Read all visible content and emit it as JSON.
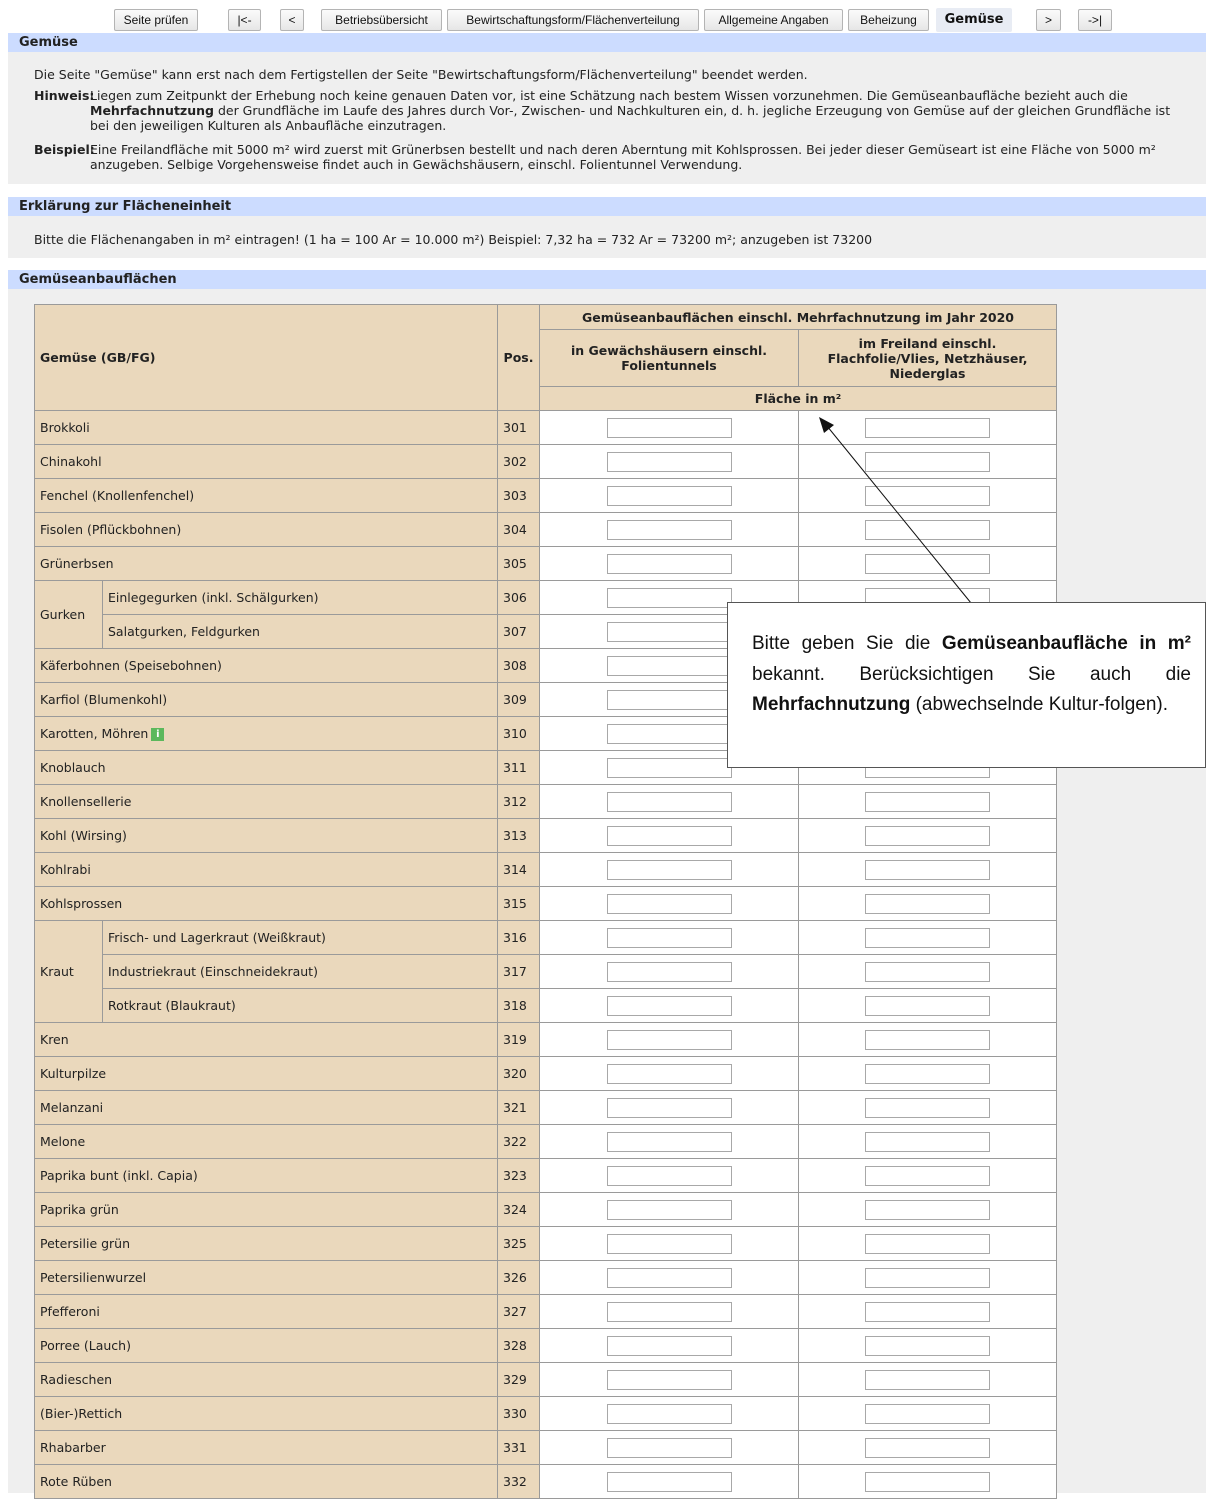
{
  "nav": {
    "check_label": "Seite prüfen",
    "first_label": "|<-",
    "prev_label": "<",
    "tab1": "Betriebsübersicht",
    "tab2": "Bewirtschaftungsform/Flächenverteilung",
    "tab3": "Allgemeine Angaben",
    "tab4": "Beheizung",
    "tab5": "Gemüse",
    "next_label": ">",
    "last_label": "->|"
  },
  "section_gemuese": {
    "title": "Gemüse",
    "intro": "Die Seite \"Gemüse\" kann erst nach dem Fertigstellen der Seite \"Bewirtschaftungsform/Flächenverteilung\" beendet werden.",
    "hint_label": "Hinweis:",
    "hint_part1": "Liegen zum Zeitpunkt der Erhebung noch keine genauen Daten vor, ist eine Schätzung nach bestem Wissen vorzunehmen. Die Gemüseanbaufläche bezieht auch die ",
    "hint_bold": "Mehrfachnutzung",
    "hint_part2": " der Grundfläche im Laufe des Jahres durch Vor-, Zwischen- und Nachkulturen ein, d. h. jegliche Erzeugung von Gemüse auf der gleichen Grundfläche ist bei den jeweiligen Kulturen als Anbaufläche einzutragen.",
    "example_label": "Beispiel:",
    "example_text": "Eine Freilandfläche mit 5000 m² wird zuerst mit Grünerbsen bestellt und nach deren Aberntung mit Kohlsprossen. Bei jeder dieser Gemüseart ist eine Fläche von 5000 m² anzugeben. Selbige Vorgehensweise findet auch in Gewächshäusern, einschl. Folientunnel Verwendung."
  },
  "section_unit": {
    "title": "Erklärung zur Flächeneinheit",
    "text": "Bitte die Flächenangaben in m² eintragen! (1 ha = 100 Ar = 10.000 m²) Beispiel: 7,32 ha = 732 Ar = 73200 m²; anzugeben ist 73200"
  },
  "section_areas": {
    "title": "Gemüseanbauflächen",
    "col_name": "Gemüse (GB/FG)",
    "col_pos": "Pos.",
    "col_group": "Gemüseanbauflächen einschl. Mehrfachnutzung im Jahr 2020",
    "col_greenhouse": "in Gewächshäusern einschl. Folientunnels",
    "col_field": "im Freiland einschl. Flachfolie/Vlies, Netzhäuser, Niederglas",
    "col_unit": "Fläche in m²",
    "info_icon": "i",
    "rows": [
      {
        "name": "Brokkoli",
        "pos": "301"
      },
      {
        "name": "Chinakohl",
        "pos": "302"
      },
      {
        "name": "Fenchel (Knollenfenchel)",
        "pos": "303"
      },
      {
        "name": "Fisolen (Pflückbohnen)",
        "pos": "304"
      },
      {
        "name": "Grünerbsen",
        "pos": "305"
      },
      {
        "group": "Gurken",
        "name": "Einlegegurken (inkl. Schälgurken)",
        "pos": "306"
      },
      {
        "name": "Salatgurken, Feldgurken",
        "pos": "307"
      },
      {
        "name": "Käferbohnen (Speisebohnen)",
        "pos": "308"
      },
      {
        "name": "Karfiol (Blumenkohl)",
        "pos": "309"
      },
      {
        "name": "Karotten, Möhren",
        "pos": "310"
      },
      {
        "name": "Knoblauch",
        "pos": "311"
      },
      {
        "name": "Knollensellerie",
        "pos": "312"
      },
      {
        "name": "Kohl (Wirsing)",
        "pos": "313"
      },
      {
        "name": "Kohlrabi",
        "pos": "314"
      },
      {
        "name": "Kohlsprossen",
        "pos": "315"
      },
      {
        "group": "Kraut",
        "name": "Frisch- und Lagerkraut (Weißkraut)",
        "pos": "316"
      },
      {
        "name": "Industriekraut (Einschneidekraut)",
        "pos": "317"
      },
      {
        "name": "Rotkraut (Blaukraut)",
        "pos": "318"
      },
      {
        "name": "Kren",
        "pos": "319"
      },
      {
        "name": "Kulturpilze",
        "pos": "320"
      },
      {
        "name": "Melanzani",
        "pos": "321"
      },
      {
        "name": "Melone",
        "pos": "322"
      },
      {
        "name": "Paprika bunt (inkl. Capia)",
        "pos": "323"
      },
      {
        "name": "Paprika grün",
        "pos": "324"
      },
      {
        "name": "Petersilie grün",
        "pos": "325"
      },
      {
        "name": "Petersilienwurzel",
        "pos": "326"
      },
      {
        "name": "Pfefferoni",
        "pos": "327"
      },
      {
        "name": "Porree (Lauch)",
        "pos": "328"
      },
      {
        "name": "Radieschen",
        "pos": "329"
      },
      {
        "name": "(Bier-)Rettich",
        "pos": "330"
      },
      {
        "name": "Rhabarber",
        "pos": "331"
      },
      {
        "name": "Rote Rüben",
        "pos": "332"
      }
    ]
  },
  "tooltip": {
    "part1": "Bitte geben Sie die ",
    "bold1": "Gemüseanbaufläche in m²",
    "part2": " bekannt. Berücksichtigen Sie auch die ",
    "bold2": "Mehrfachnutzung",
    "part3": " (abwechselnde Kultur-folgen)."
  },
  "colors": {
    "section_bar": "#ccdcff",
    "table_header": "#ead8bc",
    "info_icon": "#5cb85c",
    "panel": "#efefef"
  }
}
